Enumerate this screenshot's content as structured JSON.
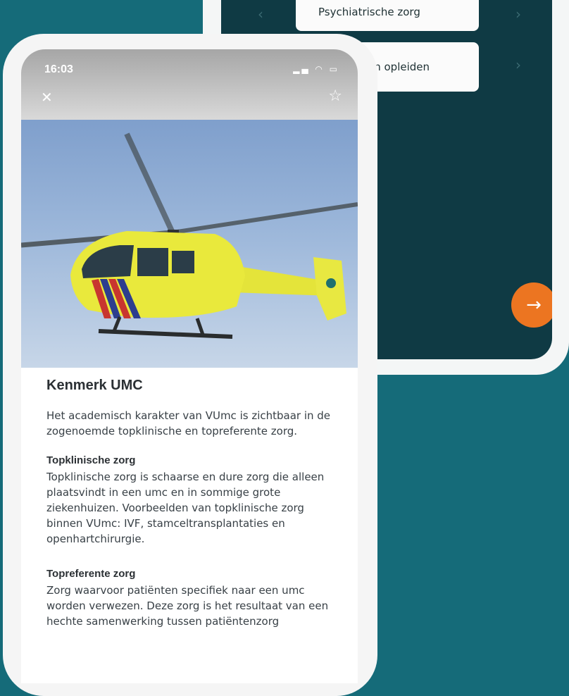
{
  "back_screen": {
    "menu_items": [
      {
        "label": "Psychiatrische zorg"
      },
      {
        "label": "en opleiden"
      }
    ],
    "next_button_icon": "arrow-right-icon",
    "accent": "#ec7521"
  },
  "front_screen": {
    "status_bar": {
      "time": "16:03"
    },
    "header": {
      "close_icon": "close-icon",
      "favorite_icon": "star-icon"
    },
    "title": "Kenmerk UMC",
    "intro": "Het academisch karakter van VUmc is zichtbaar in de zogenoemde topklinische en topreferente zorg.",
    "sections": [
      {
        "heading": "Topklinische zorg",
        "body": "Topklinische zorg is schaarse en dure zorg die alleen plaatsvindt in een umc en in sommige grote ziekenhuizen. Voorbeelden van topklinische zorg binnen VUmc: IVF, stamceltransplantaties en openhartchirurgie."
      },
      {
        "heading": "Topreferente zorg",
        "body": "Zorg waarvoor patiënten specifiek naar een umc worden verwezen. Deze zorg is het resultaat van een hechte samenwerking tussen patiëntenzorg"
      }
    ]
  },
  "colors": {
    "background": "#156b79",
    "back_screen": "#0f3a44"
  }
}
